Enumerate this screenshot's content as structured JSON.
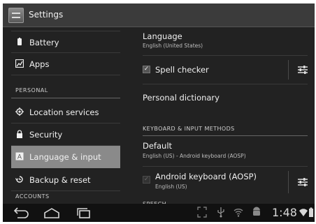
{
  "actionbar": {
    "title": "Settings"
  },
  "left": {
    "items": [
      {
        "label": "Battery",
        "icon": "battery-icon"
      },
      {
        "label": "Apps",
        "icon": "apps-icon"
      },
      {
        "label": "Location services",
        "icon": "location-icon"
      },
      {
        "label": "Security",
        "icon": "lock-icon"
      },
      {
        "label": "Language & input",
        "icon": "language-icon",
        "selected": true
      },
      {
        "label": "Backup & reset",
        "icon": "backup-icon"
      }
    ],
    "sections": {
      "personal": "PERSONAL",
      "accounts": "ACCOUNTS"
    }
  },
  "right": {
    "language": {
      "title": "Language",
      "subtitle": "English (United States)"
    },
    "spell_checker": {
      "title": "Spell checker",
      "checked": true
    },
    "personal_dictionary": {
      "title": "Personal dictionary"
    },
    "keyboard_header": "KEYBOARD & INPUT METHODS",
    "default_kb": {
      "title": "Default",
      "subtitle": "English (US) - Android keyboard (AOSP)"
    },
    "android_kb": {
      "title": "Android keyboard (AOSP)",
      "subtitle": "English (US)",
      "checked": true
    },
    "speech_header": "SPEECH"
  },
  "navbar": {
    "clock": "1:48"
  },
  "colors": {
    "selected": "#8a8a8a",
    "background": "#222222",
    "actionbar": "#3b3b3b"
  }
}
